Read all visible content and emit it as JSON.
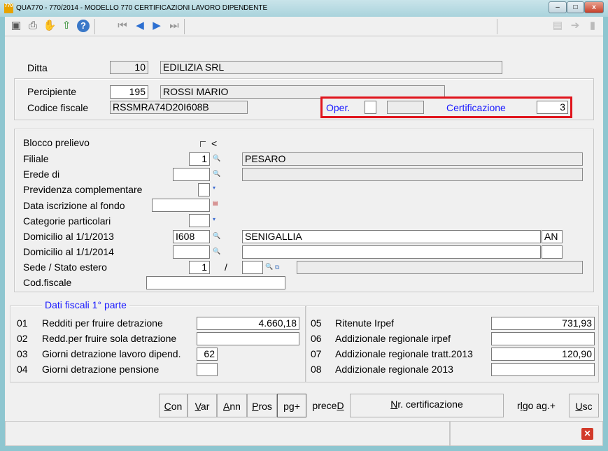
{
  "window": {
    "title": "QUA770  - 770/2014 -  MODELLO 770 CERTIFICAZIONI LAVORO DIPENDENTE",
    "app_icon": "770",
    "minimize": "–",
    "maximize": "□",
    "close": "x"
  },
  "toolbar": {
    "icons": [
      "scanner-icon",
      "print-icon",
      "hand-icon",
      "export-icon",
      "help-icon",
      "first-icon",
      "prev-icon",
      "next-icon",
      "last-icon",
      "doc-icon",
      "forward-icon",
      "page-icon"
    ]
  },
  "header": {
    "ditta_label": "Ditta",
    "ditta_code": "10",
    "ditta_name": "EDILIZIA SRL",
    "percipiente_label": "Percipiente",
    "percipiente_code": "195",
    "percipiente_name": "ROSSI MARIO",
    "codice_fiscale_label": "Codice fiscale",
    "codice_fiscale": "RSSMRA74D20I608B",
    "oper_label": "Oper.",
    "oper_value": "",
    "oper_value2": "",
    "certificazione_label": "Certificazione",
    "certificazione_value": "3"
  },
  "details": {
    "blocco_label": "Blocco prelievo",
    "blocco_mark": "<",
    "filiale_label": "Filiale",
    "filiale_code": "1",
    "filiale_name": "PESARO",
    "erede_label": "Erede di",
    "erede_code": "",
    "erede_name": "",
    "previdenza_label": "Previdenza complementare",
    "previdenza_value": "",
    "data_iscr_label": "Data iscrizione al fondo",
    "data_iscr_value": "",
    "categorie_label": "Categorie particolari",
    "categorie_value": "",
    "dom2013_label": "Domicilio al 1/1/2013",
    "dom2013_code": "I608",
    "dom2013_city": "SENIGALLIA",
    "dom2013_prov": "AN",
    "dom2014_label": "Domicilio al 1/1/2014",
    "dom2014_code": "",
    "dom2014_city": "",
    "dom2014_prov": "",
    "sede_label": "Sede / Stato estero",
    "sede_value": "1",
    "sede_sep": "/",
    "sede_value2": "",
    "sede_desc": "",
    "codfisc_label": "Cod.fiscale",
    "codfisc_value": ""
  },
  "fiscal": {
    "title": "Dati fiscali 1° parte",
    "left": [
      {
        "num": "01",
        "label": "Redditi per fruire detrazione",
        "value": "4.660,18"
      },
      {
        "num": "02",
        "label": "Redd.per fruire sola detrazione",
        "value": ""
      },
      {
        "num": "03",
        "label": "Giorni detrazione lavoro dipend.",
        "value": "62"
      },
      {
        "num": "04",
        "label": "Giorni detrazione pensione",
        "value": ""
      }
    ],
    "right": [
      {
        "num": "05",
        "label": "Ritenute Irpef",
        "value": "731,93"
      },
      {
        "num": "06",
        "label": "Addizionale regionale irpef",
        "value": ""
      },
      {
        "num": "07",
        "label": "Addizionale regionale tratt.2013",
        "value": "120,90"
      },
      {
        "num": "08",
        "label": "Addizionale regionale 2013",
        "value": ""
      }
    ]
  },
  "buttons": {
    "con": [
      "C",
      "on"
    ],
    "var": [
      "V",
      "ar"
    ],
    "ann": [
      "A",
      "nn"
    ],
    "pros": [
      "P",
      "ros"
    ],
    "pg": "pg+",
    "prec": [
      "prece",
      "D"
    ],
    "nr": [
      "N",
      "r. certificazione"
    ],
    "rigo": [
      "r",
      "l",
      "go ag.+"
    ],
    "usc": [
      "U",
      "sc"
    ]
  },
  "status": {
    "close_icon": "✕"
  }
}
